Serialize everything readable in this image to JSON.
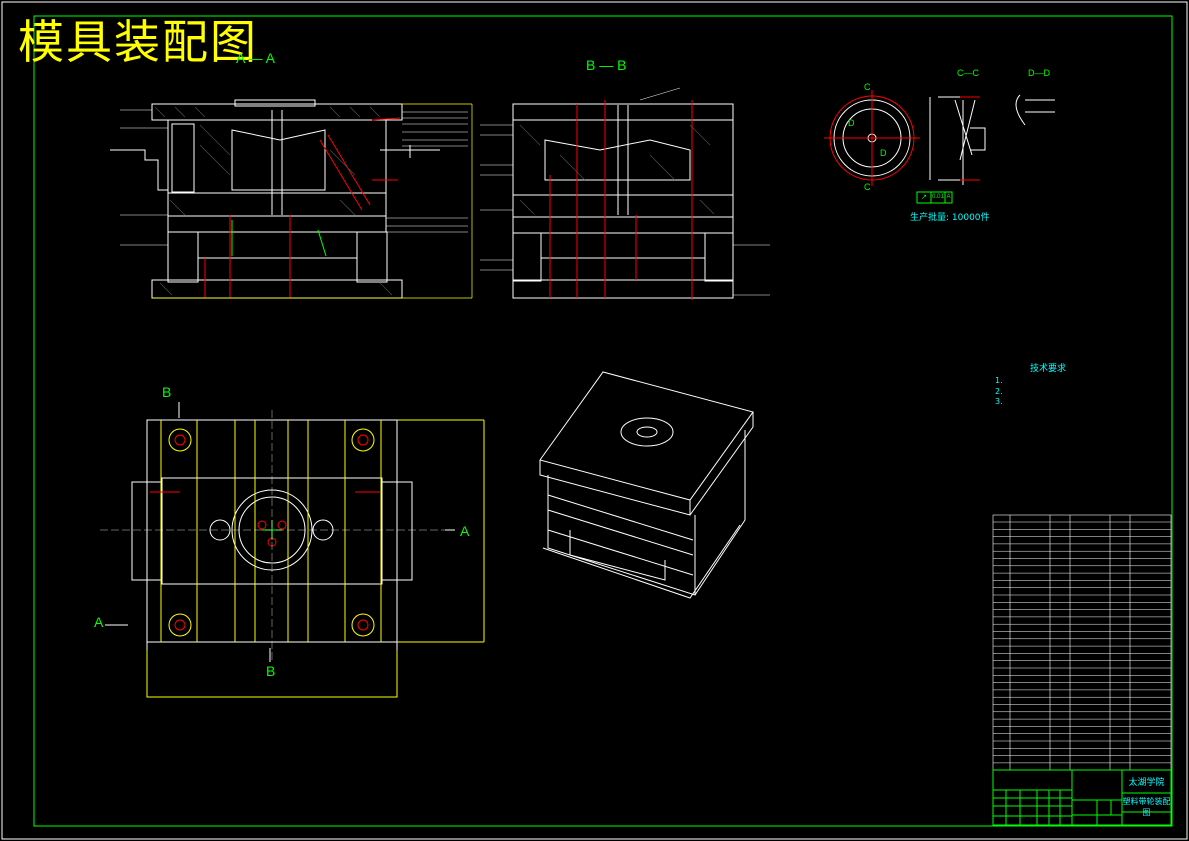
{
  "title": "模具装配图",
  "section_labels": {
    "front": "A — A",
    "side": "B — B",
    "part_section": "C—C",
    "part_detail": "D—D",
    "plan_b_top": "B",
    "plan_b_bottom": "B",
    "plan_a_left": "A",
    "plan_a_right": "A",
    "part_c_top": "C",
    "part_c_bottom": "C",
    "part_d1": "D",
    "part_d2": "D"
  },
  "part": {
    "production_qty": "生产批量: 10000件",
    "tolerance_frame": [
      "↗",
      "0.01",
      "A"
    ]
  },
  "tech_requirements": {
    "heading": "技术要求",
    "lines": [
      "1.",
      "2.",
      "3."
    ]
  },
  "title_block": {
    "school": "太湖学院",
    "drawing_name": "塑料带轮装配图"
  },
  "colors": {
    "background": "#000000",
    "title": "#ffff00",
    "border": "#00ff00",
    "lines": "#ffffff",
    "centerlines": "#ff0000",
    "dimension": "#ffff00",
    "text": "#00ffff"
  }
}
